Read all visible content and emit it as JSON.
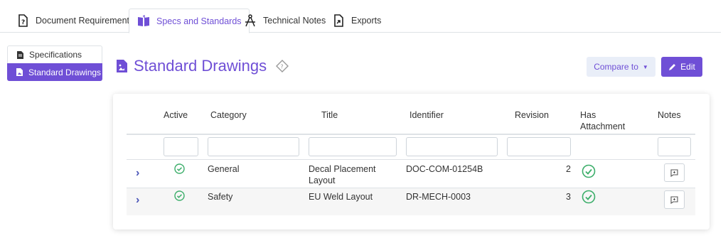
{
  "tabs": [
    {
      "label": "Document Requirements",
      "active": false
    },
    {
      "label": "Specs and Standards",
      "active": true
    },
    {
      "label": "Technical Notes",
      "active": false
    },
    {
      "label": "Exports",
      "active": false
    }
  ],
  "sidebar": {
    "items": [
      {
        "label": "Specifications",
        "active": false
      },
      {
        "label": "Standard Drawings",
        "active": true
      }
    ]
  },
  "page": {
    "title": "Standard Drawings",
    "compare_label": "Compare to",
    "edit_label": "Edit"
  },
  "table": {
    "headers": {
      "active": "Active",
      "category": "Category",
      "title": "Title",
      "identifier": "Identifier",
      "revision": "Revision",
      "has_attachment_1": "Has",
      "has_attachment_2": "Attachment",
      "notes": "Notes"
    },
    "rows": [
      {
        "active": true,
        "category": "General",
        "title_1": "Decal Placement",
        "title_2": "Layout",
        "identifier": "DOC-COM-01254B",
        "revision": "2",
        "has_attachment": true
      },
      {
        "active": true,
        "category": "Safety",
        "title_1": "EU Weld Layout",
        "title_2": "",
        "identifier": "DR-MECH-0003",
        "revision": "3",
        "has_attachment": true
      }
    ]
  },
  "colors": {
    "accent": "#6f4fd6",
    "success": "#3cae6a",
    "expand": "#4a55b8"
  }
}
